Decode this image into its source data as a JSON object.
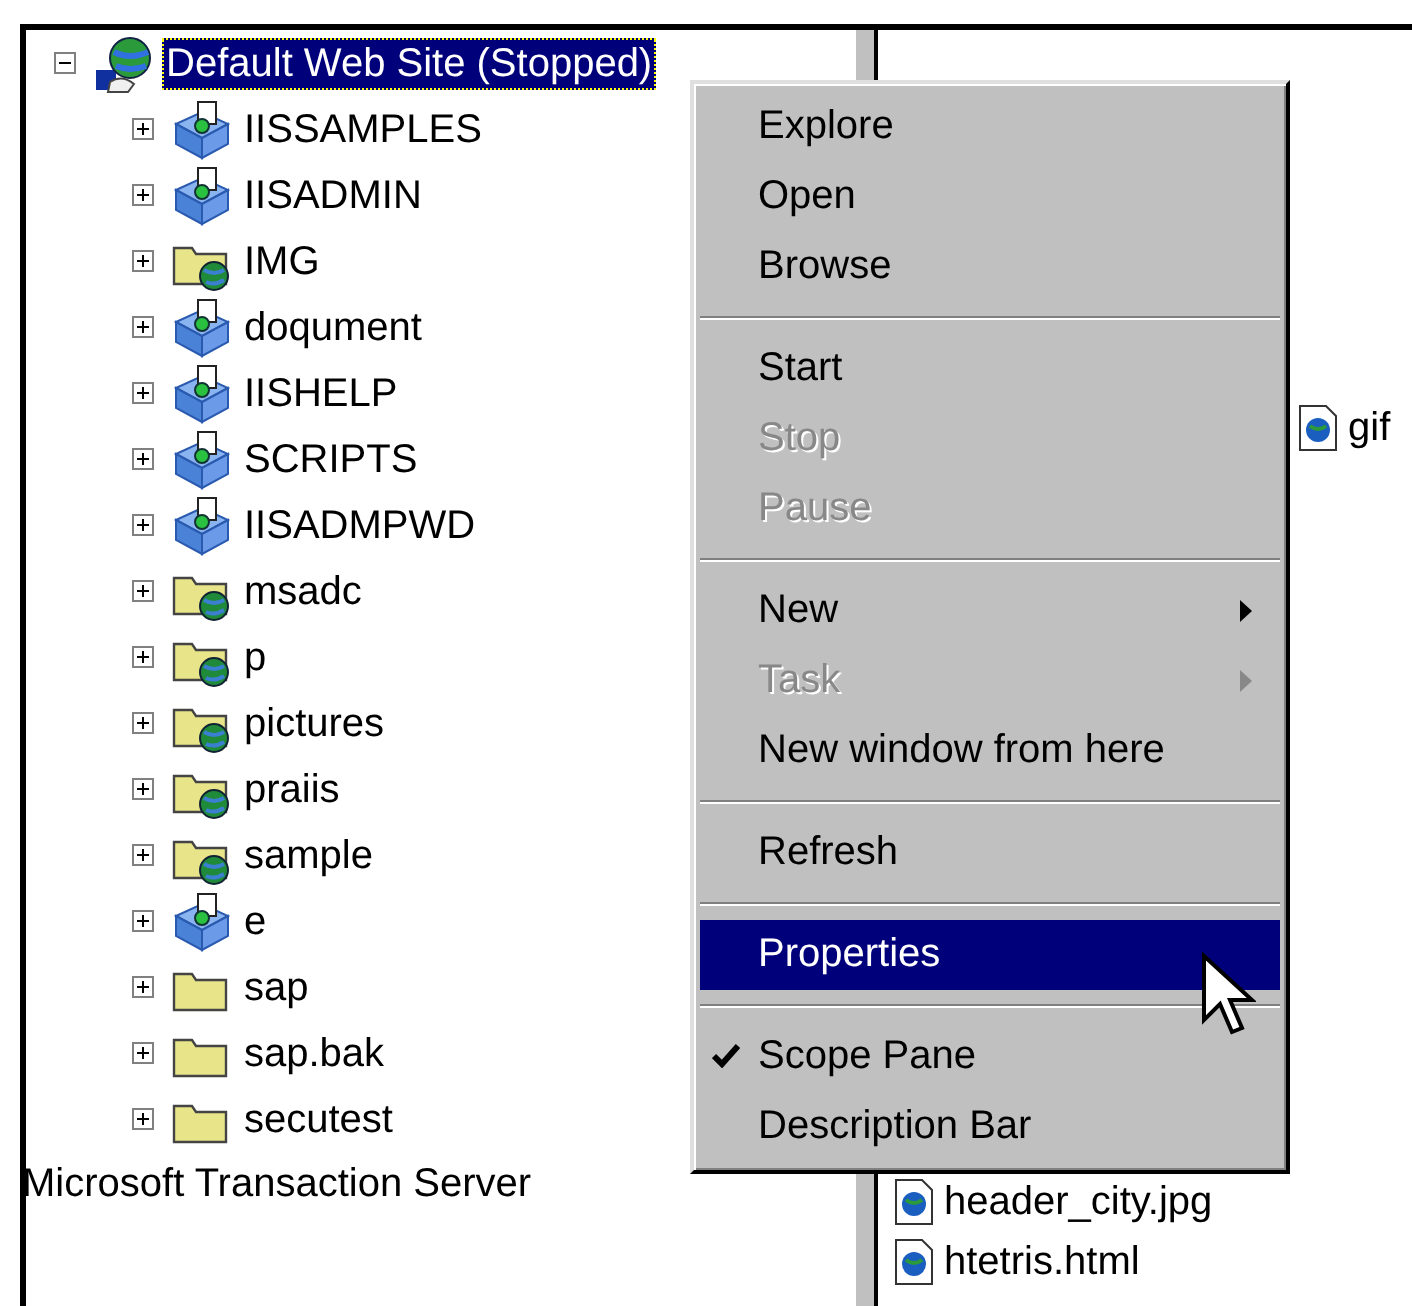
{
  "tree": {
    "root": {
      "label": "Default Web Site (Stopped)",
      "kind": "site",
      "expanded": true,
      "selected": true,
      "children": [
        {
          "label": "IISSAMPLES",
          "kind": "app",
          "expanded": false,
          "selected": false
        },
        {
          "label": "IISADMIN",
          "kind": "app",
          "expanded": false,
          "selected": false
        },
        {
          "label": "IMG",
          "kind": "vdir",
          "expanded": false,
          "selected": false
        },
        {
          "label": "doqument",
          "kind": "app",
          "expanded": false,
          "selected": false
        },
        {
          "label": "IISHELP",
          "kind": "app",
          "expanded": false,
          "selected": false
        },
        {
          "label": "SCRIPTS",
          "kind": "app",
          "expanded": false,
          "selected": false
        },
        {
          "label": "IISADMPWD",
          "kind": "app",
          "expanded": false,
          "selected": false
        },
        {
          "label": "msadc",
          "kind": "vdir",
          "expanded": false,
          "selected": false
        },
        {
          "label": "p",
          "kind": "vdir",
          "expanded": false,
          "selected": false
        },
        {
          "label": "pictures",
          "kind": "vdir",
          "expanded": false,
          "selected": false
        },
        {
          "label": "praiis",
          "kind": "vdir",
          "expanded": false,
          "selected": false
        },
        {
          "label": "sample",
          "kind": "vdir",
          "expanded": false,
          "selected": false
        },
        {
          "label": "e",
          "kind": "app",
          "expanded": false,
          "selected": false
        },
        {
          "label": "sap",
          "kind": "folder",
          "expanded": false,
          "selected": false
        },
        {
          "label": "sap.bak",
          "kind": "folder",
          "expanded": false,
          "selected": false
        },
        {
          "label": "secutest",
          "kind": "folder",
          "expanded": false,
          "selected": false
        }
      ]
    },
    "sibling": {
      "label": "Microsoft Transaction Server"
    }
  },
  "files": [
    {
      "name": "gif"
    },
    {
      "name": "header_city.jpg"
    },
    {
      "name": "htetris.html"
    }
  ],
  "context_menu": {
    "groups": [
      [
        {
          "label": "Explore",
          "disabled": false,
          "selected": false
        },
        {
          "label": "Open",
          "disabled": false,
          "selected": false
        },
        {
          "label": "Browse",
          "disabled": false,
          "selected": false
        }
      ],
      [
        {
          "label": "Start",
          "disabled": false,
          "selected": false
        },
        {
          "label": "Stop",
          "disabled": true,
          "selected": false
        },
        {
          "label": "Pause",
          "disabled": true,
          "selected": false
        }
      ],
      [
        {
          "label": "New",
          "disabled": false,
          "submenu": true,
          "selected": false
        },
        {
          "label": "Task",
          "disabled": true,
          "submenu": true,
          "selected": false
        },
        {
          "label": "New window from here",
          "disabled": false,
          "selected": false
        }
      ],
      [
        {
          "label": "Refresh",
          "disabled": false,
          "selected": false
        }
      ],
      [
        {
          "label": "Properties",
          "disabled": false,
          "selected": true
        }
      ],
      [
        {
          "label": "Scope Pane",
          "disabled": false,
          "checked": true,
          "selected": false
        },
        {
          "label": "Description Bar",
          "disabled": false,
          "checked": false,
          "selected": false
        }
      ]
    ]
  }
}
